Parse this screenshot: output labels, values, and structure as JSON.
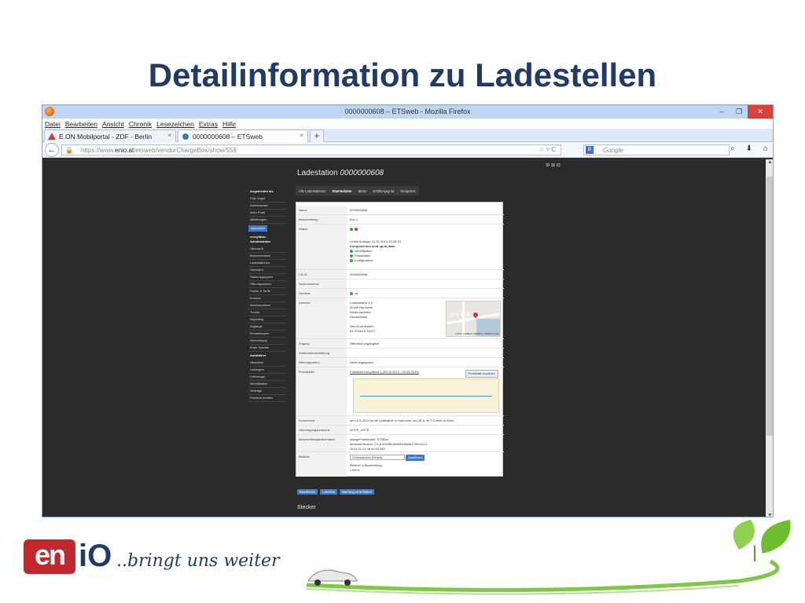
{
  "slide": {
    "title": "Detailinformation zu Ladestellen",
    "tagline": "..bringt uns  weiter",
    "logo_text": "enio"
  },
  "browser": {
    "window_title": "0000000608 – ETSweb - Mozilla Firefox",
    "menu": [
      "Datei",
      "Bearbeiten",
      "Ansicht",
      "Chronik",
      "Lesezeichen",
      "Extras",
      "Hilfe"
    ],
    "tabs": [
      {
        "label": "E.ON Mobilportal - ZDF - Berlin"
      },
      {
        "label": "0000000608 – ETSweb"
      }
    ],
    "new_tab": "+",
    "url_prefix": "https://www.",
    "url_domain": "enio.at",
    "url_path": "/etsweb/vendorChargeBox/show/558",
    "search_placeholder": "Google",
    "search_engine_letter": "8",
    "controls": {
      "minimize": "–",
      "restore": "❐",
      "close": "✕"
    }
  },
  "page": {
    "heading": "Ladestation",
    "heading_id": "0000000608",
    "top_info": "⚙ ⊞ ⊟"
  },
  "sidebar": {
    "user_label": "Angemeldet als",
    "user_name": "Fritz Vogel",
    "user_role": "Administrator",
    "items_top": [
      "Mein Profil",
      "Mitteilungen"
    ],
    "logout": "Abmelden",
    "section1": "everyWear Administrator",
    "items1": [
      "Übersicht",
      "Betreiberdaten",
      "Ladestationen",
      "Übersicht",
      "Stationsgruppen",
      "Öffnungszeiten",
      "Preise & Tarife",
      "Kunden",
      "Servicepartner",
      "Trends",
      "Reporting",
      "Zugänge",
      "Einstellungen",
      "Abrechnung",
      "Erste Schritte"
    ],
    "section2": "Autofahrer",
    "items2": [
      "Übersicht",
      "Ladungen",
      "Fahrzeuge",
      "Identifikation",
      "Verträge",
      "Problem melden"
    ]
  },
  "tabrow": {
    "back": "Alle Ladestationen",
    "tabs": [
      "Stammdaten",
      "Bilder",
      "Erfüllungsgrad",
      "Ereignisse"
    ]
  },
  "details": {
    "name_label": "Name",
    "name_value": "0000000608",
    "desc_label": "Beschreibung",
    "desc_value": "Box 1",
    "status_label": "Status",
    "status_request": "Letzte Anfrage: 21.01.2014 15:28:13",
    "status_components": "Komponenten sind up-to-date:",
    "status_items": [
      "Identifikation",
      "Preisblätter",
      "Konfiguration"
    ],
    "cbid_label": "CB-ID",
    "cbid_value": "0000000608",
    "serial_label": "Seriennummer",
    "public_label": "Sichtbar",
    "public_value": "Ja",
    "address_label": "Adresse",
    "address_lines": [
      "Lossestraße 1-3",
      "30169 Hannover",
      "Niedersachsen",
      "Deutschland",
      "",
      "Geo-Koordinaten:",
      "52.37445,9.74477"
    ],
    "map_label": "OVER",
    "map_credit": "©2014 GeoBasis-DE/BKG, ©2009 Google",
    "access_label": "Zugang",
    "access_value": "Öffentlich zugänglich",
    "directions_label": "Anfahrtsbeschreibung",
    "hours_label": "Öffnungszeiten",
    "hours_value": "Nicht angegeben",
    "price_label": "Preisblätter",
    "price_value": "Preisblatt everyWear 1 (09.05.2013 - 09.05.2020)",
    "price_button": "Preisblatt zuordnen",
    "comment_label": "Kommentar",
    "comment_value": "am 10.8.2013 ist die Ladesäule in Hannover, am 28.8. im T-Center in Wien.",
    "protocol_label": "Übertragungsprotokoll",
    "protocol_value": "OCPP_VOTE",
    "hw_label": "Beschreibungsinformation",
    "hw_lines": [
      "chargePointModel: ETSBox",
      "firmwareVersion: 1.0.8.314f55c4f9e53d5d3417f05310.0",
      "2014-01-21 06:00:04.853"
    ],
    "commands_label": "Befehle",
    "commands_select": "Zurückstellen (Reset)...",
    "commands_exec": "Ausführen",
    "commands_note": "Befehle in Bearbeitung:",
    "commands_none": "Keine"
  },
  "actions": {
    "edit": "Bearbeiten",
    "delete": "Löschen",
    "maintenance": "Wartung einschalten"
  },
  "stecker": "Stecker"
}
